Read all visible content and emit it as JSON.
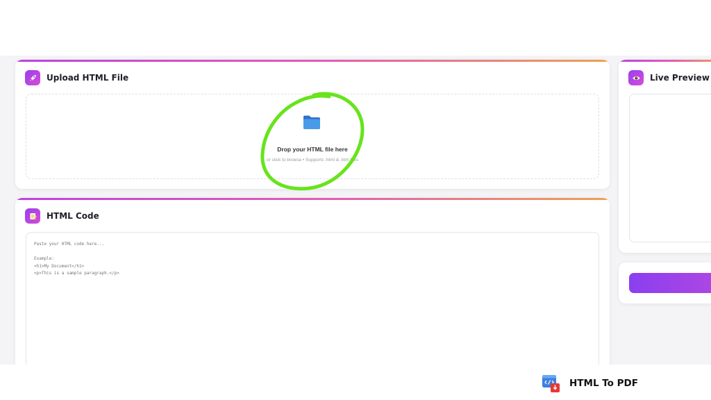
{
  "upload": {
    "title": "Upload HTML File",
    "icon": "rocket-icon",
    "drop_title": "Drop your HTML file here",
    "drop_subtitle": "or click to browse • Supports .html & .htm files"
  },
  "code": {
    "title": "HTML Code",
    "icon": "memo-icon",
    "placeholder": "Paste your HTML code here...\n\nExample:\n<h1>My Document</h1>\n<p>This is a sample paragraph.</p>"
  },
  "preview": {
    "title": "Live Preview",
    "icon": "eye-icon"
  },
  "brand": {
    "name": "HTML To PDF",
    "icon": "html-to-pdf-logo-icon"
  },
  "annotation": {
    "circle_color": "#66e41c"
  },
  "colors": {
    "accent_purple": "#9a3ef0",
    "accent_pink": "#d44cd8",
    "accent_orange": "#f0a050"
  }
}
